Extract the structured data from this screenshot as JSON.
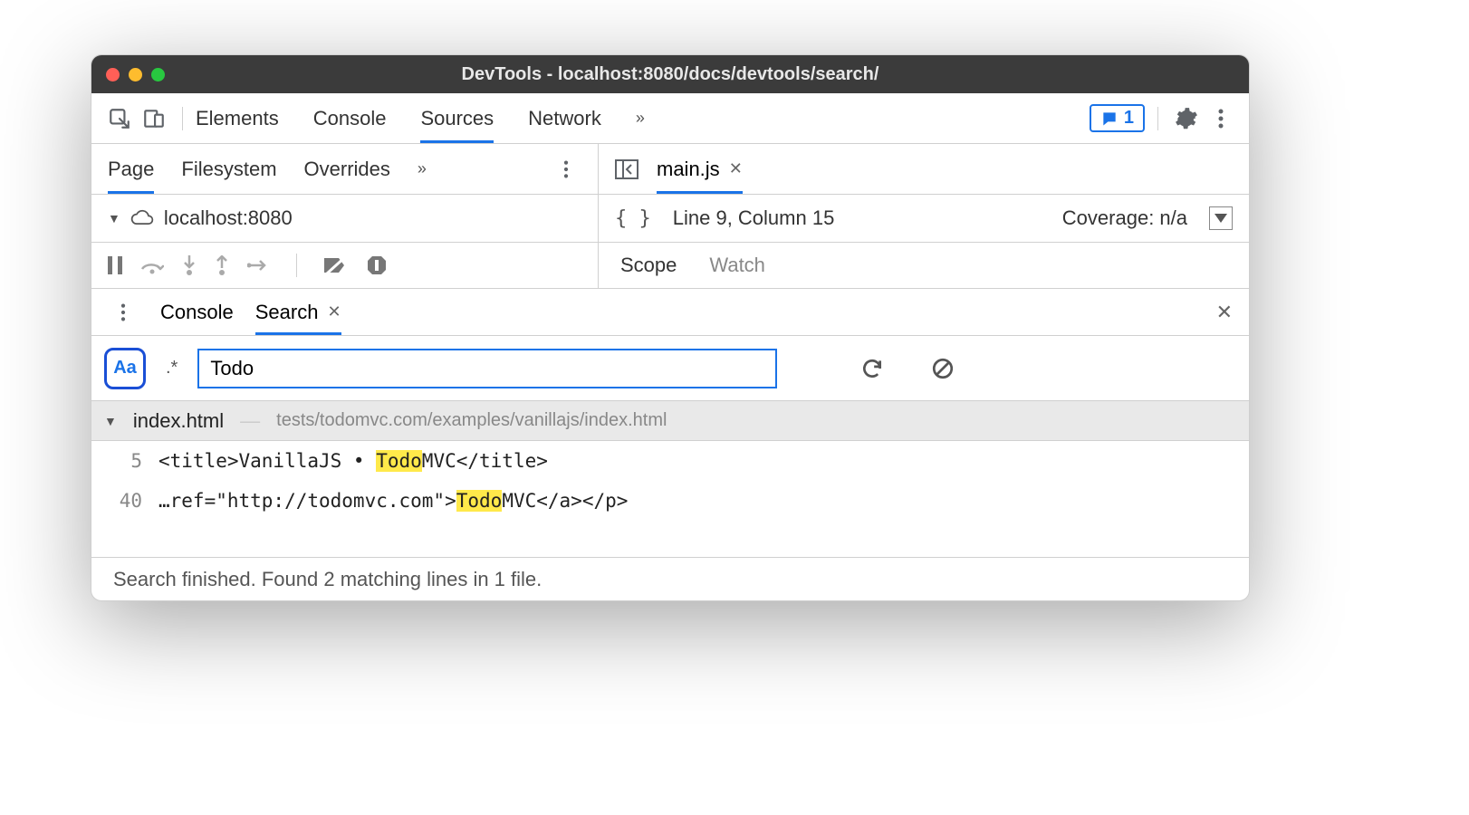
{
  "window": {
    "title": "DevTools - localhost:8080/docs/devtools/search/"
  },
  "main_tabs": {
    "elements": "Elements",
    "console": "Console",
    "sources": "Sources",
    "network": "Network",
    "more": "»"
  },
  "badge": {
    "count": "1"
  },
  "sources": {
    "subtabs": {
      "page": "Page",
      "filesystem": "Filesystem",
      "overrides": "Overrides",
      "more": "»"
    },
    "tree_host": "localhost:8080",
    "editor_tab": "main.js",
    "status_line": "Line 9, Column 15",
    "coverage": "Coverage: n/a"
  },
  "debug_tabs": {
    "scope": "Scope",
    "watch": "Watch"
  },
  "drawer": {
    "kabob": "⋮",
    "console": "Console",
    "search": "Search"
  },
  "search": {
    "aa": "Aa",
    "regex": ".*",
    "query": "Todo",
    "result_file": "index.html",
    "result_subpath": "tests/todomvc.com/examples/vanillajs/index.html",
    "r1_ln": "5",
    "r1_pre": "<title>VanillaJS • ",
    "r1_hl": "Todo",
    "r1_post": "MVC</title>",
    "r2_ln": "40",
    "r2_pre": "…ref=\"http://todomvc.com\">",
    "r2_hl": "Todo",
    "r2_post": "MVC</a></p>"
  },
  "status": "Search finished.  Found 2 matching lines in 1 file."
}
